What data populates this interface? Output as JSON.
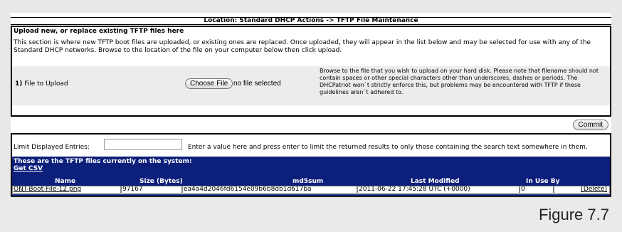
{
  "page": {
    "title": "Location: Standard DHCP Actions -> TFTP File Maintenance",
    "figure_label": "Figure 7.7"
  },
  "upload": {
    "heading": "Upload new, or replace existing TFTP files here",
    "description": "This section is where new TFTP boot files are uploaded, or existing ones are replaced. Once uploaded, they will appear in the list below and may be selected for use with any of the Standard DHCP networks. Browse to the location of the file on your computer below then click upload.",
    "step_number": "1)",
    "file_label": "File to Upload",
    "choose_button": "Choose File",
    "no_file_text": "no file selected",
    "help_text": "Browse to the file that you wish to upload on your hard disk. Please note that filename should not contain spaces or other special characters other than underscores, dashes or periods. The DHCPatriot won`t strictly enforce this, but problems may be encountered with TFTP if these guidelines aren`t adhered to."
  },
  "commit": {
    "label": "Commit"
  },
  "filter": {
    "label": "Limit Displayed Entries:",
    "value": "",
    "help": "Enter a value here and press enter to limit the returned results to only those containing the search text somewhere in them."
  },
  "files": {
    "title": "These are the TFTP files currently on the system:",
    "get_csv": "Get CSV",
    "columns": {
      "name": "Name",
      "size": "Size (Bytes)",
      "md5": "md5sum",
      "modified": "Last Modified",
      "in_use": "In Use By"
    },
    "rows": [
      {
        "name": "ONT-Boot-File-12.png",
        "size": "97167",
        "md5": "ea4a4d2046fd6154e09b6b8db1d617ba",
        "modified": "2011-06-22 17:45:28 UTC (+0000)",
        "in_use": "0",
        "action": "[Delete]"
      }
    ]
  }
}
